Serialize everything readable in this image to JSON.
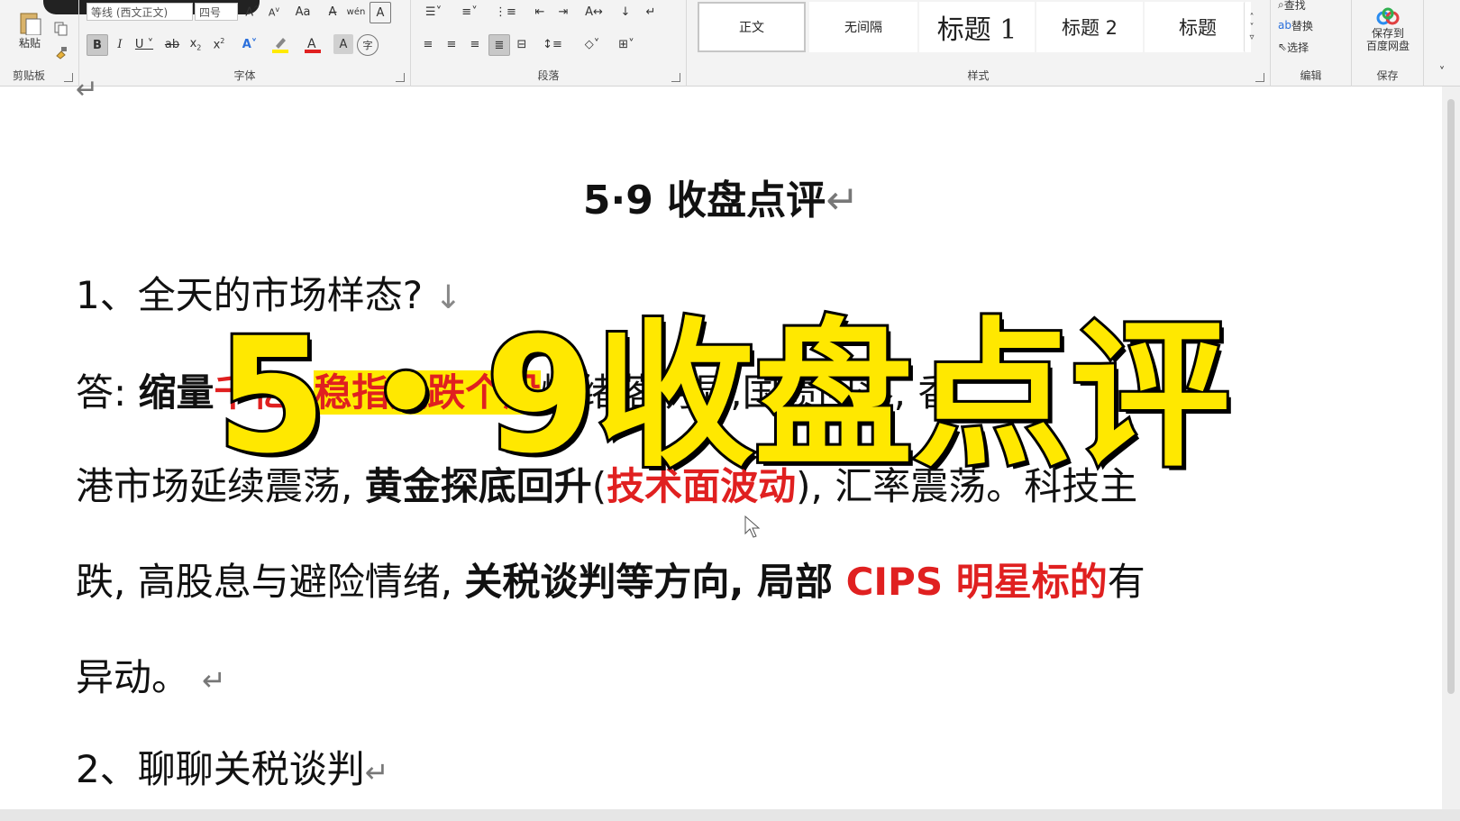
{
  "ribbon": {
    "clipboard": {
      "label": "剪贴板",
      "paste_label": "粘贴"
    },
    "font": {
      "label": "字体",
      "font_name": "等线 (西文正文)",
      "font_size": "四号",
      "change_case": "Aa"
    },
    "paragraph": {
      "label": "段落"
    },
    "styles": {
      "label": "样式",
      "items": [
        "正文",
        "无间隔",
        "标题 1",
        "标题 2",
        "标题"
      ]
    },
    "editing": {
      "label": "编辑",
      "find": "查找",
      "replace": "替换",
      "select": "选择"
    },
    "save": {
      "label": "保存",
      "save_to_cloud": "保存到\n百度网盘"
    }
  },
  "document": {
    "title": "5·9 收盘点评",
    "q1": "1、全天的市场样态?",
    "answer_line1": {
      "prefix": "答: ",
      "bold1": "缩量",
      "red1": "千亿",
      "sep": ", ",
      "hl_red": "稳指数跌个股",
      "normal1": "情绪落",
      "normal2": "明显,国债",
      "normal3": "回落, 香"
    },
    "answer_line2": {
      "normal1": "港市场延续震荡, ",
      "bold1": "黄金探底回升",
      "paren_open": "(",
      "red1": "技术面波动",
      "paren_close": ")",
      "normal2": ", 汇率震荡。科技主"
    },
    "answer_line3": {
      "normal1": "跌, 高股息与避险情绪, ",
      "bold1": "关税谈判等方向, 局部 ",
      "red1": "CIPS 明星标的",
      "normal2": "有"
    },
    "answer_line4": {
      "normal1": "异动。"
    },
    "q2": "2、聊聊关税谈判",
    "paragraph_mark": "↵",
    "line_break_mark": "↓"
  },
  "overlay": {
    "text": "5・9收盘点评"
  },
  "colors": {
    "highlight": "#ffea00",
    "red_text": "#e02020",
    "overlay_fill": "#ffe800"
  }
}
